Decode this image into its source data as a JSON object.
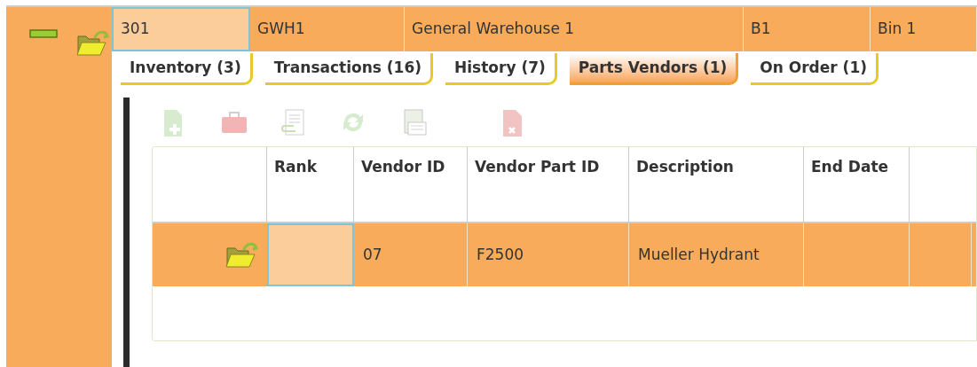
{
  "record": {
    "fields": [
      {
        "value": "301",
        "selected": true
      },
      {
        "value": "GWH1",
        "selected": false
      },
      {
        "value": "General Warehouse 1",
        "selected": false
      },
      {
        "value": "B1",
        "selected": false
      },
      {
        "value": "Bin 1",
        "selected": false
      }
    ]
  },
  "tabs": [
    {
      "label": "Inventory (3)",
      "selected": false
    },
    {
      "label": "Transactions (16)",
      "selected": false
    },
    {
      "label": "History (7)",
      "selected": false
    },
    {
      "label": "Parts Vendors (1)",
      "selected": true
    },
    {
      "label": "On Order (1)",
      "selected": false
    }
  ],
  "toolbar": [
    {
      "kind": "new",
      "disabled": true
    },
    {
      "kind": "toolbox",
      "disabled": true
    },
    {
      "kind": "attach",
      "disabled": true
    },
    {
      "kind": "refresh",
      "disabled": true
    },
    {
      "kind": "csv",
      "disabled": true
    },
    {
      "kind": "delete",
      "disabled": true
    }
  ],
  "table": {
    "columns": [
      "Rank",
      "Vendor ID",
      "Vendor Part ID",
      "Description",
      "End Date"
    ],
    "rows": [
      {
        "selected": true,
        "cells": [
          {
            "selected": true
          },
          {
            "value": "07",
            "selected": false
          },
          {
            "value": "F2500",
            "selected": false
          },
          {
            "value": "Mueller Hydrant",
            "selected": false
          },
          {
            "selected": false
          },
          {
            "selected": false
          }
        ]
      }
    ]
  }
}
